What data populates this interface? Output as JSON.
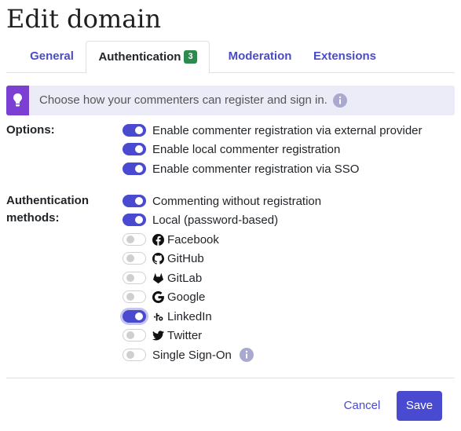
{
  "page": {
    "title": "Edit domain"
  },
  "tabs": [
    {
      "label": "General"
    },
    {
      "label": "Authentication",
      "badge": "3",
      "active": true
    },
    {
      "label": "Moderation"
    },
    {
      "label": "Extensions"
    }
  ],
  "info": {
    "text": "Choose how your commenters can register and sign in."
  },
  "options": {
    "label": "Options:",
    "items": [
      {
        "label": "Enable commenter registration via external provider",
        "enabled": true
      },
      {
        "label": "Enable local commenter registration",
        "enabled": true
      },
      {
        "label": "Enable commenter registration via SSO",
        "enabled": true
      }
    ]
  },
  "auth_methods": {
    "label_line1": "Authentication",
    "label_line2": "methods:",
    "items": [
      {
        "label": "Commenting without registration",
        "enabled": true,
        "icon": ""
      },
      {
        "label": "Local (password-based)",
        "enabled": true,
        "icon": ""
      },
      {
        "label": "Facebook",
        "enabled": false,
        "icon": "facebook-icon"
      },
      {
        "label": "GitHub",
        "enabled": false,
        "icon": "github-icon"
      },
      {
        "label": "GitLab",
        "enabled": false,
        "icon": "gitlab-icon"
      },
      {
        "label": "Google",
        "enabled": false,
        "icon": "google-icon"
      },
      {
        "label": "LinkedIn",
        "enabled": true,
        "icon": "linkedin-icon"
      },
      {
        "label": "Twitter",
        "enabled": false,
        "icon": "twitter-icon"
      },
      {
        "label": "Single Sign-On",
        "enabled": false,
        "icon": ""
      }
    ]
  },
  "footer": {
    "cancel_label": "Cancel",
    "save_label": "Save"
  },
  "colors": {
    "accent": "#4a4ad1",
    "badge": "#2d8a4f",
    "bulb": "#7b3fd1",
    "info_bg": "#ececf8"
  }
}
